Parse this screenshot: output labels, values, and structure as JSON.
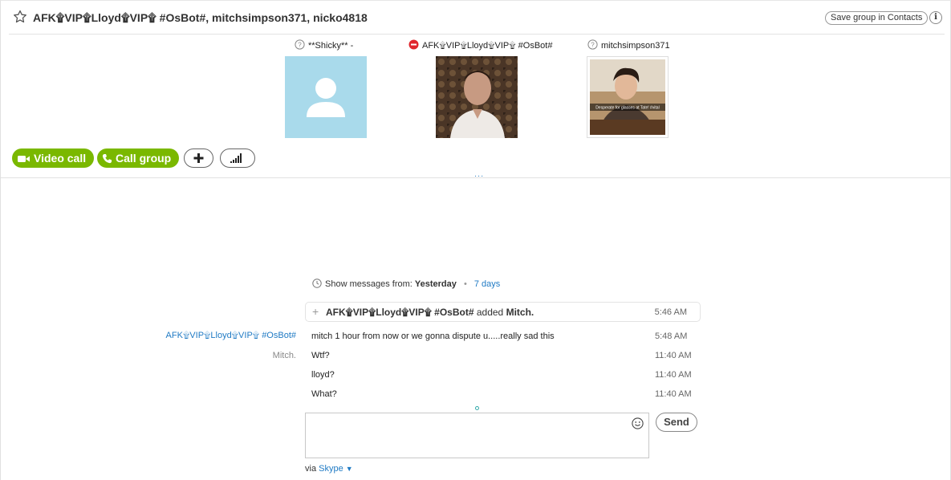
{
  "header": {
    "title": "AFK۩VIP۩Lloyd۩VIP۩ #OsBot#, mitchsimpson371, nicko4818",
    "save_contacts_label": "Save group in Contacts",
    "info_label": "i"
  },
  "participants": [
    {
      "name": "**Shicky** -",
      "status": "unknown",
      "avatar": "default-avatar"
    },
    {
      "name": "AFK۩VIP۩Lloyd۩VIP۩ #OsBot#",
      "status": "busy",
      "avatar": "photo"
    },
    {
      "name": "mitchsimpson371",
      "status": "unknown",
      "avatar": "photo",
      "photo_caption": "Desperate for glasses at Tate! #vital"
    }
  ],
  "actions": {
    "video_call_label": "Video call",
    "call_group_label": "Call group",
    "add_label": "+",
    "more_label": "..."
  },
  "history": {
    "prefix": "Show messages from:",
    "current": "Yesterday",
    "separator": "•",
    "option": "7 days"
  },
  "event": {
    "actor": "AFK۩VIP۩Lloyd۩VIP۩ #OsBot#",
    "verb": "added",
    "target": "Mitch.",
    "time": "5:46 AM"
  },
  "messages": [
    {
      "sender": "AFK۩VIP۩Lloyd۩VIP۩ #OsBot#",
      "text": "mitch 1 hour from now or we gonna dispute u.....really sad this",
      "time": "5:48 AM"
    },
    {
      "sender": "Mitch.",
      "text": "Wtf?",
      "time": "11:40 AM"
    },
    {
      "sender": "",
      "text": "lloyd?",
      "time": "11:40 AM"
    },
    {
      "sender": "",
      "text": "What?",
      "time": "11:40 AM"
    }
  ],
  "compose": {
    "placeholder": "",
    "send_label": "Send",
    "via_prefix": "via",
    "via_service": "Skype"
  },
  "colors": {
    "green": "#7ab800",
    "link": "#1f7ac4",
    "busy": "#e0262d"
  }
}
